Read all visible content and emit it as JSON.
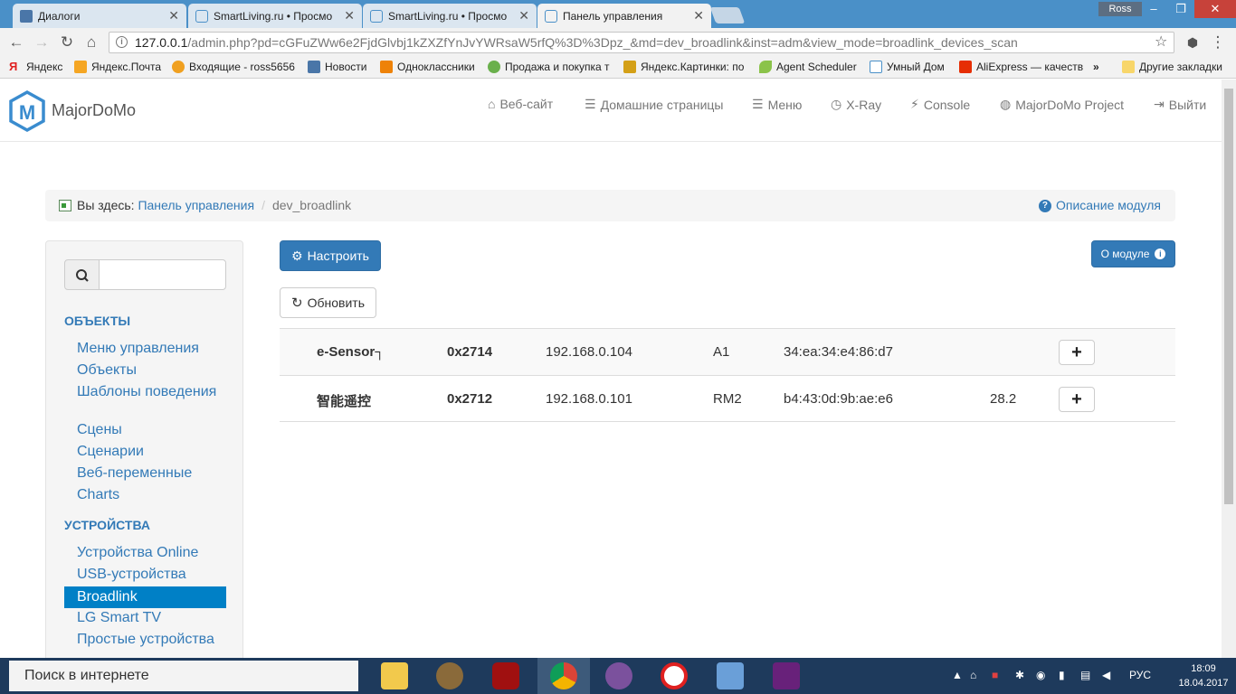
{
  "browser": {
    "tabs": [
      {
        "label": "Диалоги",
        "active": false
      },
      {
        "label": "SmartLiving.ru • Просмо",
        "active": false
      },
      {
        "label": "SmartLiving.ru • Просмо",
        "active": false
      },
      {
        "label": "Панель управления",
        "active": true
      }
    ],
    "profile": "Ross",
    "url_host": "127.0.0.1",
    "url_rest": "/admin.php?pd=cGFuZWw6e2FjdGlvbj1kZXZfYnJvYWRsaW5rfQ%3D%3Dpz_&md=dev_broadlink&inst=adm&view_mode=broadlink_devices_scan",
    "bookmarks": [
      {
        "label": "Яндекс",
        "color": "#e02020"
      },
      {
        "label": "Яндекс.Почта",
        "color": "#f5a623"
      },
      {
        "label": "Входящие - ross5656",
        "color": "#f0a020"
      },
      {
        "label": "Новости",
        "color": "#4a76a8"
      },
      {
        "label": "Одноклассники",
        "color": "#ee8208"
      },
      {
        "label": "Продажа и покупка т",
        "color": "#6ab04c"
      },
      {
        "label": "Яндекс.Картинки: по",
        "color": "#d4a017"
      },
      {
        "label": "Agent Scheduler",
        "color": "#8bc34a"
      },
      {
        "label": "Умный Дом",
        "color": "#4a90c8"
      },
      {
        "label": "AliExpress — качеств",
        "color": "#e62e04"
      }
    ],
    "bookmarks_more": "»",
    "other_bookmarks": "Другие закладки"
  },
  "navbar": {
    "brand": "MajorDoMo",
    "links": [
      {
        "icon": "home-icon",
        "glyph": "⌂",
        "label": "Веб-сайт"
      },
      {
        "icon": "list-icon",
        "glyph": "☰",
        "label": "Домашние страницы"
      },
      {
        "icon": "menu-icon",
        "glyph": "☰",
        "label": "Меню"
      },
      {
        "icon": "clock-icon",
        "glyph": "◷",
        "label": "X-Ray"
      },
      {
        "icon": "bolt-icon",
        "glyph": "⚡",
        "label": "Console"
      },
      {
        "icon": "globe-icon",
        "glyph": "◍",
        "label": "MajorDoMo Project"
      },
      {
        "icon": "logout-icon",
        "glyph": "⇥",
        "label": "Выйти"
      }
    ]
  },
  "breadcrumb": {
    "label": "Вы здесь:",
    "link": "Панель управления",
    "separator": "/",
    "current": "dev_broadlink",
    "module_desc": "Описание модуля"
  },
  "sidebar": {
    "search_placeholder": "",
    "sections": [
      {
        "title": "ОБЪЕКТЫ",
        "items": [
          "Меню управления",
          "Объекты",
          "Шаблоны поведения",
          "Сцены",
          "Сценарии",
          "Веб-переменные",
          "Charts"
        ]
      },
      {
        "title": "УСТРОЙСТВА",
        "items": [
          "Устройства Online",
          "USB-устройства",
          "Broadlink",
          "LG Smart TV",
          "Простые устройства"
        ]
      }
    ],
    "active_item": "Broadlink"
  },
  "main": {
    "configure_label": "Настроить",
    "refresh_label": "Обновить",
    "about_label": "О модуле",
    "devices": [
      {
        "name": "e-Sensor┐",
        "code": "0x2714",
        "ip": "192.168.0.104",
        "model": "A1",
        "mac": "34:ea:34:e4:86:d7",
        "value": "",
        "add": "+"
      },
      {
        "name": "智能遥控",
        "code": "0x2712",
        "ip": "192.168.0.101",
        "model": "RM2",
        "mac": "b4:43:0d:9b:ae:e6",
        "value": "28.2",
        "add": "+"
      }
    ]
  },
  "taskbar": {
    "search_text": "Поиск в интернете",
    "lang": "РУС",
    "time": "18:09",
    "date": "18.04.2017"
  }
}
